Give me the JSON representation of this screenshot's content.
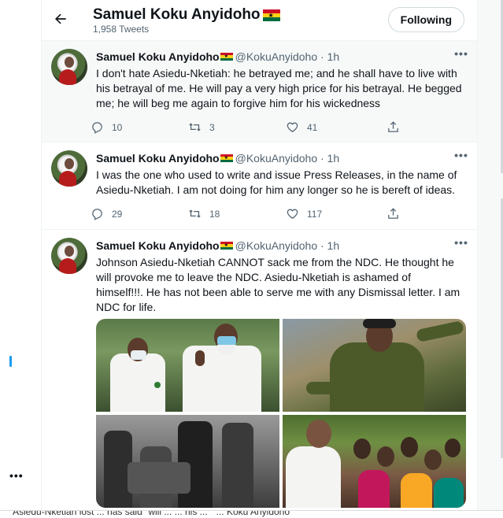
{
  "header": {
    "title": "Samuel Koku Anyidoho",
    "tweet_count": "1,958 Tweets",
    "follow_label": "Following"
  },
  "tweets": [
    {
      "name": "Samuel Koku Anyidoho",
      "handle": "@KokuAnyidoho · 1h",
      "text": "I don't hate Asiedu-Nketiah: he betrayed me; and he shall have to live with\nhis betrayal of me.  He will pay a very high price for his betrayal.  He begged\nme; he will beg me again to forgive him for his wickedness",
      "replies": "10",
      "retweets": "3",
      "likes": "41"
    },
    {
      "name": "Samuel Koku Anyidoho",
      "handle": "@KokuAnyidoho · 1h",
      "text": "I was the one who used to write and issue Press Releases, in the name of\nAsiedu-Nketiah. I am not doing for him any longer so he is bereft of ideas.",
      "replies": "29",
      "retweets": "18",
      "likes": "117"
    },
    {
      "name": "Samuel Koku Anyidoho",
      "handle": "@KokuAnyidoho · 1h",
      "text": "Johnson Asiedu-Nketiah CANNOT  sack me from the NDC. He thought he\nwill provoke me to leave the NDC.   Asiedu-Nketiah is ashamed of\nhimself!!!.  He has not been able to serve me with any Dismissal letter. I am\nNDC for life.",
      "media": [
        "photo-1",
        "photo-2",
        "photo-3",
        "photo-4"
      ]
    }
  ],
  "bottom_caption": "Asiedu-Nketiah lost ... has said \"will ... ... his ... \" ... Koku Anyidoho",
  "icons": {
    "back": "arrow-left-icon",
    "more": "more-horizontal-icon",
    "reply": "reply-icon",
    "retweet": "retweet-icon",
    "like": "heart-icon",
    "share": "share-icon",
    "flag": "ghana-flag-icon"
  },
  "colors": {
    "text": "#0f1419",
    "secondary": "#536471",
    "accent": "#1d9bf0",
    "flag_red": "#ce1126",
    "flag_yellow": "#fcd116",
    "flag_green": "#006b3f"
  }
}
